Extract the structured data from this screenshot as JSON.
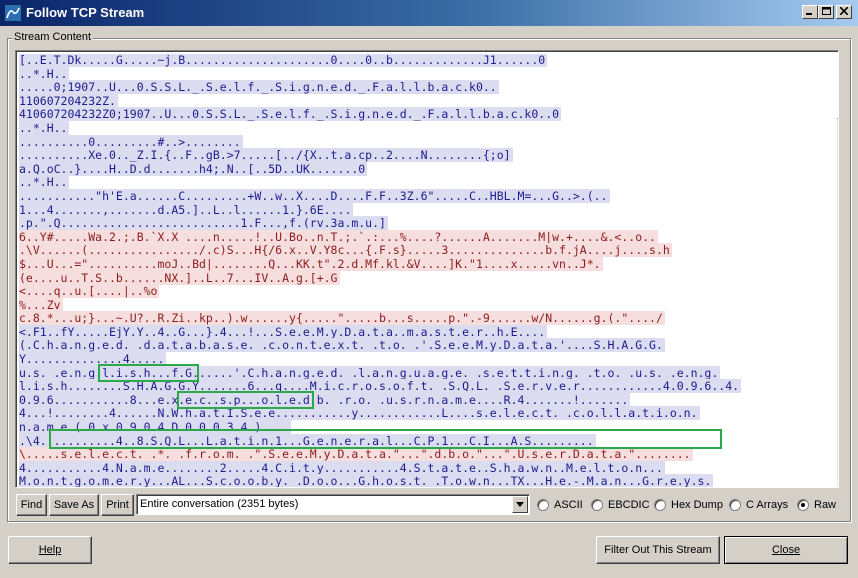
{
  "window": {
    "title": "Follow TCP Stream"
  },
  "group": {
    "label": "Stream Content"
  },
  "stream_lines": [
    {
      "dir": "c",
      "text": "[..E.T.Dk.....G.....~j.B.....................0....0..b.............J1......0"
    },
    {
      "dir": "c",
      "text": "..*.H.."
    },
    {
      "dir": "c",
      "text": ".....0;1907..U...0.S.S.L._.S.e.l.f._.S.i.g.n.e.d._.F.a.l.l.b.a.c.k0.."
    },
    {
      "dir": "c",
      "text": "110607204232Z."
    },
    {
      "dir": "c",
      "text": "410607204232Z0;1907..U...0.S.S.L._.S.e.l.f._.S.i.g.n.e.d._.F.a.l.l.b.a.c.k0..0"
    },
    {
      "dir": "c",
      "text": "..*.H.."
    },
    {
      "dir": "c",
      "text": "..........0.........#..>........"
    },
    {
      "dir": "c",
      "text": "..........Xe.0.._Z.I.{..F..gB.>7.....[../{X..t.a.cp..2....N........{;o]"
    },
    {
      "dir": "c",
      "text": "a.Q.oC..}....H..D.d.......h4;.N..[..5D..UK.......0"
    },
    {
      "dir": "c",
      "text": "..*.H.."
    },
    {
      "dir": "c",
      "text": "...........\"h'E.a......C.........+W..w..X....D....F.F..3Z.6\".....C..HBL.M=...G..>.(.."
    },
    {
      "dir": "c",
      "text": "1...4.......,.......d.A5.]..L..l......1.}.6E...."
    },
    {
      "dir": "c",
      "text": ".p.\".Q..........................1.F...,f.(rv.3a.m.u.]"
    },
    {
      "dir": "s",
      "text": "6..Y#.....Wa.2.;.B.`X.X_....n.....!..U.Bo..n.T.;.`.:...%....?......A.......M|w.+....&.<..o.."
    },
    {
      "dir": "s",
      "text": ".\\V......(................/.c)S...H{/6.x..V.Y8c...{.F.s}.....3..............b.f.jA....j....s.h"
    },
    {
      "dir": "s",
      "text": "$...U...=\"..........moJ..Bd|........Q...KK.t\".2.d.Mf.kl.&V....]K.\"1....x.....vn..J*."
    },
    {
      "dir": "s",
      "text": "(e....u..T.S..b......NX.]..L..7...IV..A.g.[+.G"
    },
    {
      "dir": "s",
      "text": "<....q..u.[....|..%o"
    },
    {
      "dir": "s",
      "text": "%...Zv"
    },
    {
      "dir": "s",
      "text": "c.8.*...u;}...~.U?..R.Zi..kp..).w......y{.....\".....b...s.....p.\".-9......w/N......g.(.\"..../"
    },
    {
      "dir": "c",
      "text": "<.F1..fY.....EjY.Y..4..G...}.4...!...S.e.e.M.y.D.a.t.a..m.a.s.t.e.r..h.E...."
    },
    {
      "dir": "c",
      "text": "(.C.h.a.n.g.e.d. .d.a.t.a.b.a.s.e. .c.o.n.t.e.x.t. .t.o. .'.S.e.e.M.y.D.a.t.a.'....S.H.A.G.G."
    },
    {
      "dir": "c",
      "text": "Y..............4....."
    },
    {
      "dir": "c",
      "text": "u.s._.e.n.g.l.i.s.h...f.G......'.C.h.a.n.g.e.d. .l.a.n.g.u.a.g.e. .s.e.t.t.i.n.g. .t.o. .u.s._.e.n.g."
    },
    {
      "dir": "c",
      "text": "l.i.s.h........S.H.A.G.G.Y.......6...q....M.i.c.r.o.s.o.f.t. .S.Q.L. .S.e.r.v.e.r............4.0.9.6..4."
    },
    {
      "dir": "c",
      "text": "0.9.6...........8...e.x.e.c..s.p...o.l.e.d.b._.r.o._.u.s.r.n.a.m.e....R.4.......!......."
    },
    {
      "dir": "c",
      "text": "4...!........4......N.W.h.a.t.I.S.e.e...........y............L....s.e.l.e.c.t. .c.o.l.l.a.t.i.o.n."
    },
    {
      "dir": "c",
      "text": "n.a.m.e.(.0.x.0.9.0.4.D.0.0.0.3.4.)...."
    },
    {
      "dir": "c",
      "text": ".\\4...........4..8.S.Q.L...L.a.t.i.n.1...G.e.n.e.r.a.l...C.P.1...C.I...A.S........."
    },
    {
      "dir": "s",
      "text": "\\.....s.e.l.e.c.t. .*. .f.r.o.m. .\".S.e.e.M.y.D.a.t.a.\"...\".d.b.o.\"...\".U.s.e.r.D.a.t.a.\"........"
    },
    {
      "dir": "c",
      "text": "4...........4.N.a.m.e........2.....4.C.i.t.y...........4.S.t.a.t.e..S.h.a.w.n..M.e.l.t.o.n..."
    },
    {
      "dir": "c",
      "text": "M.o.n.t.g.o.m.e.r.y...AL...S.c.o.o.b.y. .D.o.o...G.h.o.s.t. .T.o.w.n...TX...H.e.-.M.a.n...G.r.e.y.s."
    },
    {
      "dir": "c",
      "text": "k.u.l.l...TN...K.r.i.n.g.e.r...G.r.e.y.s.k.u.l.l...TN..........|"
    }
  ],
  "toolbar": {
    "find_label": "Find",
    "save_as_label": "Save As",
    "print_label": "Print",
    "conversation_value": "Entire conversation (2351 bytes)",
    "radio_ascii": "ASCII",
    "radio_ebcdic": "EBCDIC",
    "radio_hexdump": "Hex Dump",
    "radio_carrays": "C Arrays",
    "radio_raw": "Raw",
    "selected_format": "Raw"
  },
  "footer": {
    "help_label": "Help",
    "filter_label": "Filter Out This Stream",
    "close_label": "Close"
  },
  "colors": {
    "client_text": "#1c1c8c",
    "client_bg": "#dcdcf0",
    "server_text": "#8c1c1c",
    "server_bg": "#f6dede",
    "highlight_box": "#2aa84a"
  }
}
